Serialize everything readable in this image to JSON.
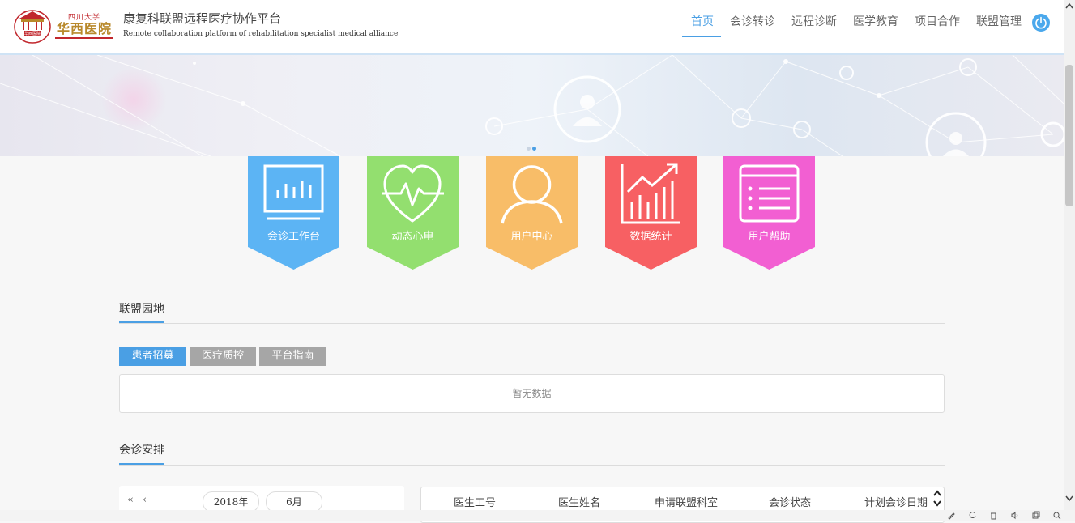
{
  "header": {
    "logo": {
      "seal_text": "华西医院",
      "line1": "四川大学",
      "line2": "华西医院"
    },
    "title": "康复科联盟远程医疗协作平台",
    "subtitle": "Remote collaboration platform of rehabilitation specialist medical alliance"
  },
  "nav": {
    "items": [
      {
        "label": "首页",
        "active": true
      },
      {
        "label": "会诊转诊",
        "active": false
      },
      {
        "label": "远程诊断",
        "active": false
      },
      {
        "label": "医学教育",
        "active": false
      },
      {
        "label": "项目合作",
        "active": false
      },
      {
        "label": "联盟管理",
        "active": false
      }
    ],
    "power_icon": "power-icon"
  },
  "banner": {
    "slides": 2,
    "active_slide": 2
  },
  "tiles": [
    {
      "label": "会诊工作台",
      "icon": "monitor-chart-icon",
      "color": "#5cb4f4"
    },
    {
      "label": "动态心电",
      "icon": "heart-ecg-icon",
      "color": "#93df6f"
    },
    {
      "label": "用户中心",
      "icon": "user-icon",
      "color": "#f8bd68"
    },
    {
      "label": "数据统计",
      "icon": "growth-chart-icon",
      "color": "#f76063"
    },
    {
      "label": "用户帮助",
      "icon": "help-list-icon",
      "color": "#f25fd2"
    }
  ],
  "alliance": {
    "title": "联盟园地",
    "tabs": [
      {
        "label": "患者招募",
        "active": true
      },
      {
        "label": "医疗质控",
        "active": false
      },
      {
        "label": "平台指南",
        "active": false
      }
    ],
    "empty_text": "暂无数据"
  },
  "schedule": {
    "title": "会诊安排",
    "calendar": {
      "prev_year": "«",
      "prev_month": "‹",
      "year": "2018年",
      "month": "6月"
    },
    "table_headers": [
      "医生工号",
      "医生姓名",
      "申请联盟科室",
      "会诊状态",
      "计划会诊日期"
    ]
  },
  "colors": {
    "accent": "#4a9fe4",
    "tab_inactive": "#a6a6a6"
  }
}
